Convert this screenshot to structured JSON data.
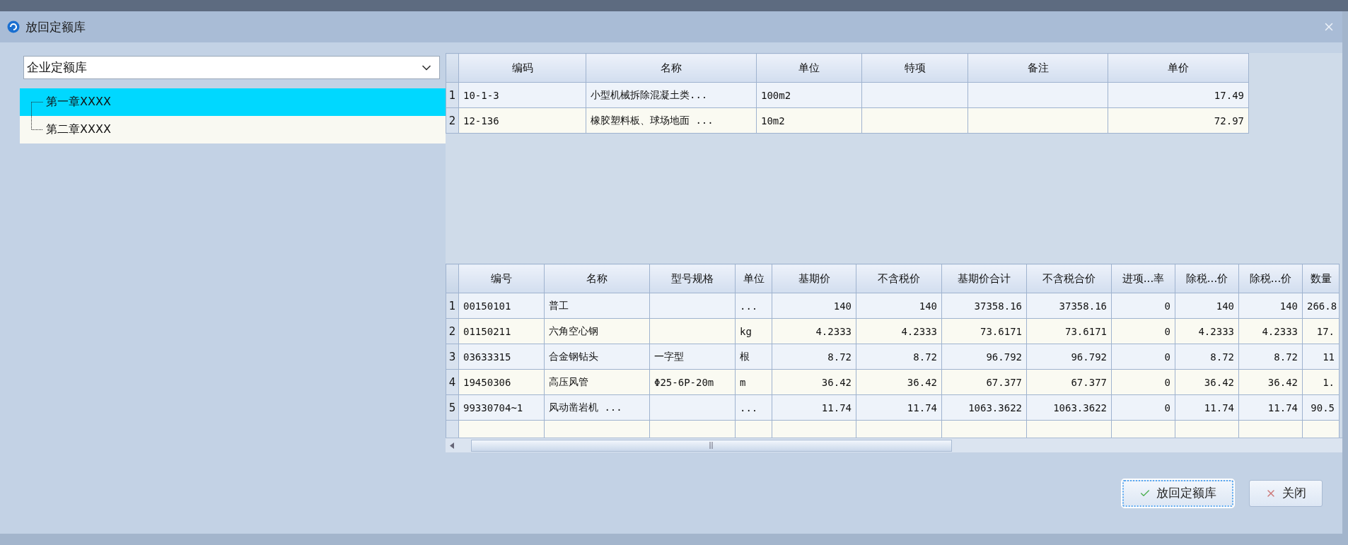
{
  "window": {
    "title": "放回定额库"
  },
  "library_select": {
    "value": "企业定额库"
  },
  "tree": [
    {
      "label": "第一章XXXX",
      "selected": true
    },
    {
      "label": "第二章XXXX",
      "selected": false
    }
  ],
  "quota_table": {
    "columns": [
      "编码",
      "名称",
      "单位",
      "特项",
      "备注",
      "单价"
    ],
    "rows": [
      {
        "index": "1",
        "cells": [
          "10-1-3",
          "小型机械拆除混凝土类...",
          "100m2",
          "",
          "",
          "17.49"
        ]
      },
      {
        "index": "2",
        "cells": [
          "12-136",
          "橡胶塑料板、球场地面 ...",
          "10m2",
          "",
          "",
          "72.97"
        ]
      }
    ]
  },
  "material_table": {
    "columns": [
      "编号",
      "名称",
      "型号规格",
      "单位",
      "基期价",
      "不含税价",
      "基期价合计",
      "不含税合价",
      "进项...率",
      "除税...价",
      "除税...价",
      "数量"
    ],
    "rows": [
      {
        "index": "1",
        "cells": [
          "00150101",
          "普工",
          "",
          "...",
          "140",
          "140",
          "37358.16",
          "37358.16",
          "0",
          "140",
          "140",
          "266.8"
        ]
      },
      {
        "index": "2",
        "cells": [
          "01150211",
          "六角空心钢",
          "",
          "kg",
          "4.2333",
          "4.2333",
          "73.6171",
          "73.6171",
          "0",
          "4.2333",
          "4.2333",
          "17."
        ]
      },
      {
        "index": "3",
        "cells": [
          "03633315",
          "合金钢钻头",
          "一字型",
          "根",
          "8.72",
          "8.72",
          "96.792",
          "96.792",
          "0",
          "8.72",
          "8.72",
          "11"
        ]
      },
      {
        "index": "4",
        "cells": [
          "19450306",
          "高压风管",
          "Φ25-6P-20m",
          "m",
          "36.42",
          "36.42",
          "67.377",
          "67.377",
          "0",
          "36.42",
          "36.42",
          "1."
        ]
      },
      {
        "index": "5",
        "cells": [
          "99330704~1",
          "风动凿岩机 ...",
          "",
          "...",
          "11.74",
          "11.74",
          "1063.3622",
          "1063.3622",
          "0",
          "11.74",
          "11.74",
          "90.5"
        ]
      }
    ]
  },
  "buttons": [
    {
      "label": "放回定额库",
      "kind": "confirm",
      "focused": true
    },
    {
      "label": "关闭",
      "kind": "close",
      "focused": false
    }
  ]
}
